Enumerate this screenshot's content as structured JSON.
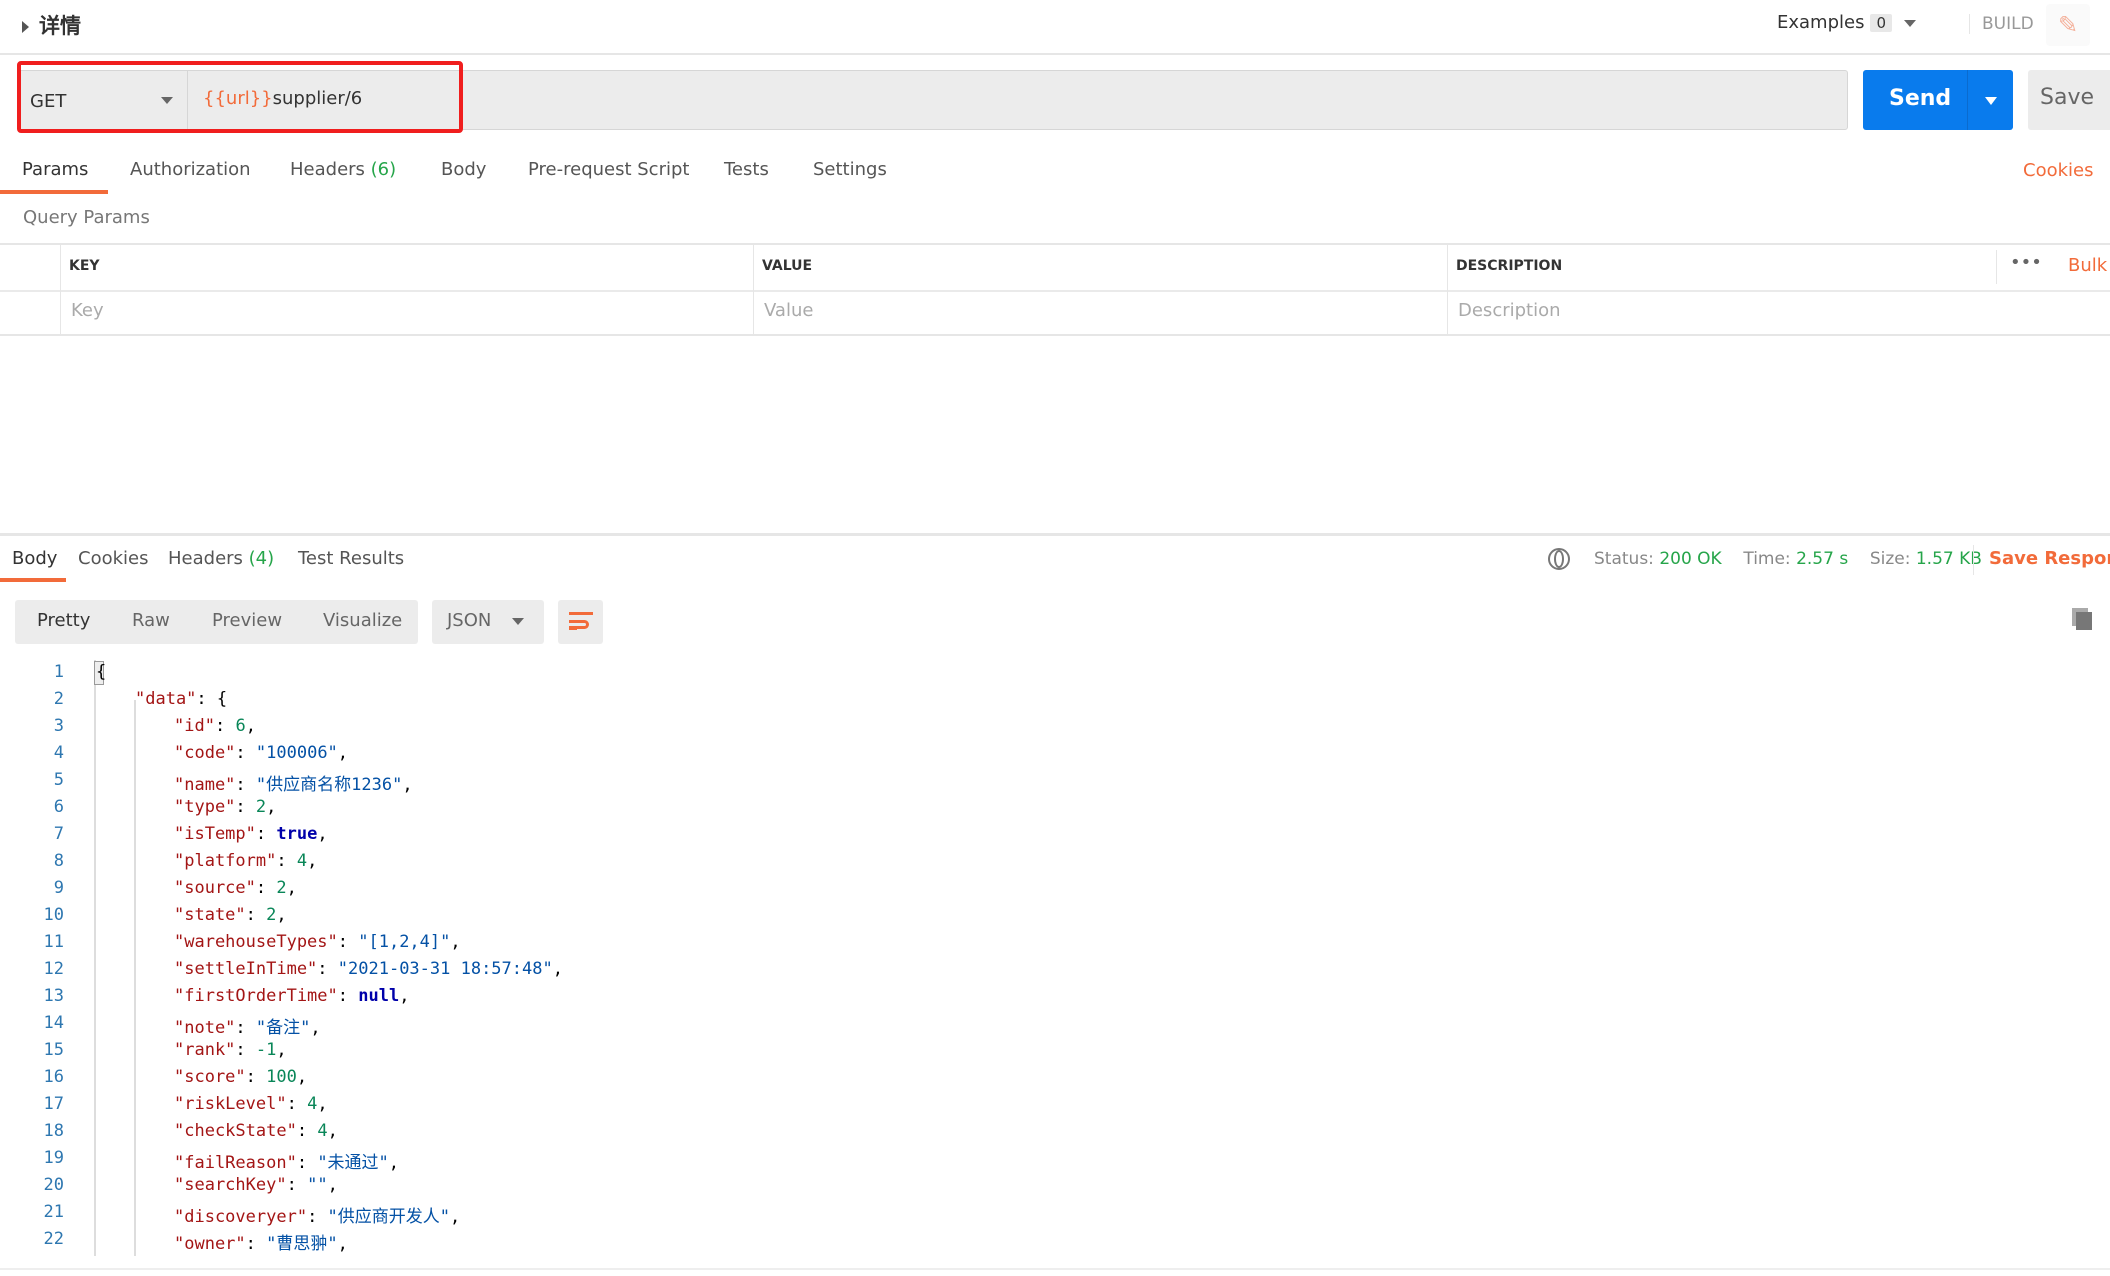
{
  "header": {
    "title": "详情",
    "examples_label": "Examples",
    "examples_count": "0",
    "build_label": "BUILD",
    "edit_icon": "pencil-icon"
  },
  "request": {
    "method": "GET",
    "url_variable": "{{url}}",
    "url_path": "supplier/6",
    "send_label": "Send",
    "save_label": "Save",
    "highlight_color": "#f01e1e"
  },
  "request_tabs": [
    {
      "label": "Params",
      "count": ""
    },
    {
      "label": "Authorization",
      "count": ""
    },
    {
      "label": "Headers",
      "count": "(6)"
    },
    {
      "label": "Body",
      "count": ""
    },
    {
      "label": "Pre-request Script",
      "count": ""
    },
    {
      "label": "Tests",
      "count": ""
    },
    {
      "label": "Settings",
      "count": ""
    }
  ],
  "cookies_link": "Cookies",
  "query_params": {
    "title": "Query Params",
    "columns": [
      "KEY",
      "VALUE",
      "DESCRIPTION"
    ],
    "placeholders": [
      "Key",
      "Value",
      "Description"
    ],
    "bulk_label": "Bulk Edit",
    "more_icon": "ellipsis-icon"
  },
  "response": {
    "tabs": [
      {
        "label": "Body",
        "count": ""
      },
      {
        "label": "Cookies",
        "count": ""
      },
      {
        "label": "Headers",
        "count": "(4)"
      },
      {
        "label": "Test Results",
        "count": ""
      }
    ],
    "status_label": "Status:",
    "status": "200 OK",
    "time_label": "Time:",
    "time": "2.57 s",
    "size_label": "Size:",
    "size": "1.57 KB",
    "save_response": "Save Response",
    "views": [
      "Pretty",
      "Raw",
      "Preview",
      "Visualize"
    ],
    "format": "JSON",
    "accent": "#f26b3a",
    "success": "#26a54a"
  },
  "code_lines": [
    [
      0,
      [
        [
          "p",
          "{"
        ]
      ]
    ],
    [
      1,
      [
        [
          "k",
          "\"data\""
        ],
        [
          "p",
          ": {"
        ]
      ]
    ],
    [
      2,
      [
        [
          "k",
          "\"id\""
        ],
        [
          "p",
          ": "
        ],
        [
          "n",
          "6"
        ],
        [
          "p",
          ","
        ]
      ]
    ],
    [
      2,
      [
        [
          "k",
          "\"code\""
        ],
        [
          "p",
          ": "
        ],
        [
          "s",
          "\"100006\""
        ],
        [
          "p",
          ","
        ]
      ]
    ],
    [
      2,
      [
        [
          "k",
          "\"name\""
        ],
        [
          "p",
          ": "
        ],
        [
          "s",
          "\"供应商名称1236\""
        ],
        [
          "p",
          ","
        ]
      ]
    ],
    [
      2,
      [
        [
          "k",
          "\"type\""
        ],
        [
          "p",
          ": "
        ],
        [
          "n",
          "2"
        ],
        [
          "p",
          ","
        ]
      ]
    ],
    [
      2,
      [
        [
          "k",
          "\"isTemp\""
        ],
        [
          "p",
          ": "
        ],
        [
          "b",
          "true"
        ],
        [
          "p",
          ","
        ]
      ]
    ],
    [
      2,
      [
        [
          "k",
          "\"platform\""
        ],
        [
          "p",
          ": "
        ],
        [
          "n",
          "4"
        ],
        [
          "p",
          ","
        ]
      ]
    ],
    [
      2,
      [
        [
          "k",
          "\"source\""
        ],
        [
          "p",
          ": "
        ],
        [
          "n",
          "2"
        ],
        [
          "p",
          ","
        ]
      ]
    ],
    [
      2,
      [
        [
          "k",
          "\"state\""
        ],
        [
          "p",
          ": "
        ],
        [
          "n",
          "2"
        ],
        [
          "p",
          ","
        ]
      ]
    ],
    [
      2,
      [
        [
          "k",
          "\"warehouseTypes\""
        ],
        [
          "p",
          ": "
        ],
        [
          "s",
          "\"[1,2,4]\""
        ],
        [
          "p",
          ","
        ]
      ]
    ],
    [
      2,
      [
        [
          "k",
          "\"settleInTime\""
        ],
        [
          "p",
          ": "
        ],
        [
          "s",
          "\"2021-03-31 18:57:48\""
        ],
        [
          "p",
          ","
        ]
      ]
    ],
    [
      2,
      [
        [
          "k",
          "\"firstOrderTime\""
        ],
        [
          "p",
          ": "
        ],
        [
          "b",
          "null"
        ],
        [
          "p",
          ","
        ]
      ]
    ],
    [
      2,
      [
        [
          "k",
          "\"note\""
        ],
        [
          "p",
          ": "
        ],
        [
          "s",
          "\"备注\""
        ],
        [
          "p",
          ","
        ]
      ]
    ],
    [
      2,
      [
        [
          "k",
          "\"rank\""
        ],
        [
          "p",
          ": "
        ],
        [
          "n",
          "-1"
        ],
        [
          "p",
          ","
        ]
      ]
    ],
    [
      2,
      [
        [
          "k",
          "\"score\""
        ],
        [
          "p",
          ": "
        ],
        [
          "n",
          "100"
        ],
        [
          "p",
          ","
        ]
      ]
    ],
    [
      2,
      [
        [
          "k",
          "\"riskLevel\""
        ],
        [
          "p",
          ": "
        ],
        [
          "n",
          "4"
        ],
        [
          "p",
          ","
        ]
      ]
    ],
    [
      2,
      [
        [
          "k",
          "\"checkState\""
        ],
        [
          "p",
          ": "
        ],
        [
          "n",
          "4"
        ],
        [
          "p",
          ","
        ]
      ]
    ],
    [
      2,
      [
        [
          "k",
          "\"failReason\""
        ],
        [
          "p",
          ": "
        ],
        [
          "s",
          "\"未通过\""
        ],
        [
          "p",
          ","
        ]
      ]
    ],
    [
      2,
      [
        [
          "k",
          "\"searchKey\""
        ],
        [
          "p",
          ": "
        ],
        [
          "s",
          "\"\""
        ],
        [
          "p",
          ","
        ]
      ]
    ],
    [
      2,
      [
        [
          "k",
          "\"discoveryer\""
        ],
        [
          "p",
          ": "
        ],
        [
          "s",
          "\"供应商开发人\""
        ],
        [
          "p",
          ","
        ]
      ]
    ],
    [
      2,
      [
        [
          "k",
          "\"owner\""
        ],
        [
          "p",
          ": "
        ],
        [
          "s",
          "\"曹思翀\""
        ],
        [
          "p",
          ","
        ]
      ]
    ]
  ]
}
